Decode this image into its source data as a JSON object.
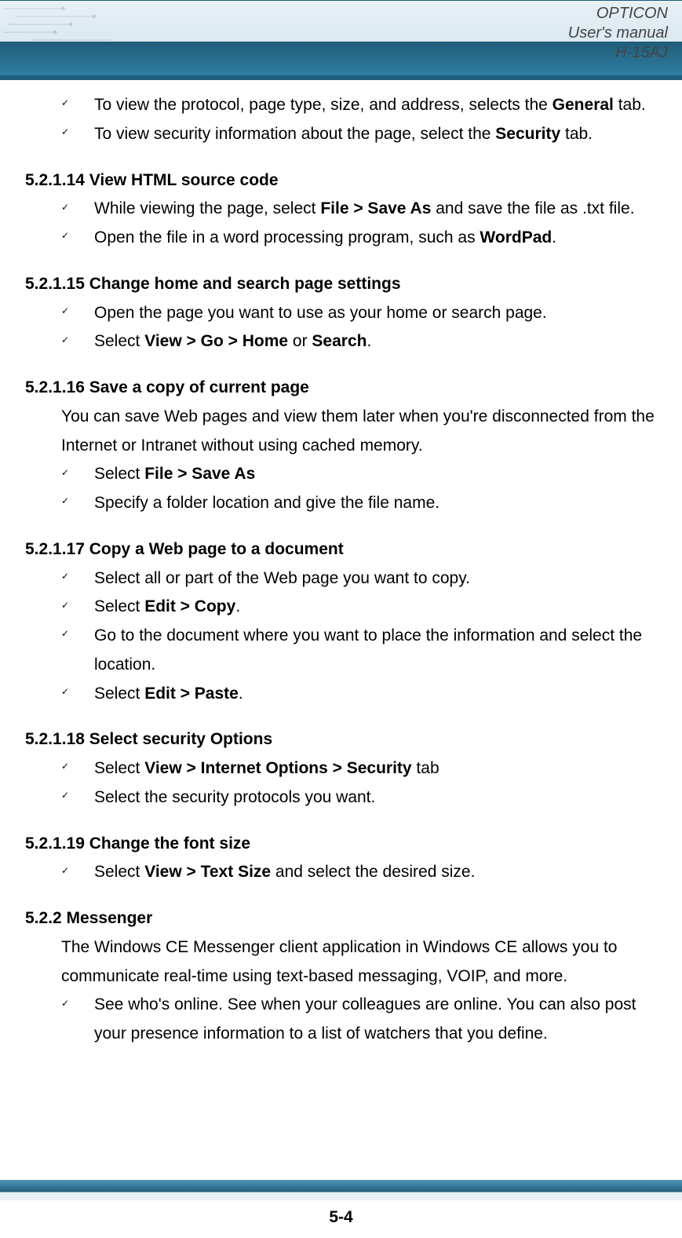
{
  "header": {
    "line1": "OPTICON",
    "line2": "User's manual",
    "line3": "H-15AJ"
  },
  "intro_items": [
    {
      "pre": "To view the protocol, page type, size, and address, selects the ",
      "bold": "General",
      "post": " tab."
    },
    {
      "pre": "To view security information about the page, select the ",
      "bold": "Security",
      "post": " tab."
    }
  ],
  "sections": [
    {
      "heading": "5.2.1.14 View HTML source code",
      "items": [
        {
          "pre": "While viewing the page, select ",
          "bold": "File > Save As",
          "post": " and save the file as .txt file."
        },
        {
          "pre": "Open the file in a word processing program, such as ",
          "bold": "WordPad",
          "post": "."
        }
      ]
    },
    {
      "heading": "5.2.1.15 Change home and search page settings",
      "items": [
        {
          "pre": "Open the page you want to use as your home or search page.",
          "bold": "",
          "post": ""
        },
        {
          "pre": "Select ",
          "bold": "View > Go > Home",
          "post": " or ",
          "bold2": "Search",
          "post2": "."
        }
      ]
    },
    {
      "heading": "5.2.1.16 Save a copy of current page",
      "para": "You can save Web pages and view them later when you're disconnected from the Internet or Intranet without using cached memory.",
      "items": [
        {
          "pre": "Select ",
          "bold": "File > Save As",
          "post": ""
        },
        {
          "pre": "Specify a folder location and give the file name.",
          "bold": "",
          "post": ""
        }
      ]
    },
    {
      "heading": "5.2.1.17 Copy a Web page to a document",
      "items": [
        {
          "pre": "Select all or part of the Web page you want to copy.",
          "bold": "",
          "post": ""
        },
        {
          "pre": "Select ",
          "bold": "Edit > Copy",
          "post": "."
        },
        {
          "pre": "Go to the document where you want to place the information and select the location.",
          "bold": "",
          "post": ""
        },
        {
          "pre": "Select ",
          "bold": "Edit > Paste",
          "post": "."
        }
      ]
    },
    {
      "heading": "5.2.1.18 Select security Options",
      "items": [
        {
          "pre": "Select ",
          "bold": "View > Internet Options > Security",
          "post": " tab"
        },
        {
          "pre": "Select the security protocols you want.",
          "bold": "",
          "post": ""
        }
      ]
    },
    {
      "heading": "5.2.1.19 Change the font size",
      "items": [
        {
          "pre": "Select ",
          "bold": "View > Text Size",
          "post": " and select the desired size."
        }
      ]
    },
    {
      "heading": "5.2.2 Messenger",
      "para": "The Windows CE Messenger client application in Windows CE allows you to communicate real-time using text-based messaging, VOIP, and more.",
      "items": [
        {
          "pre": "See who's online. See when your colleagues are online. You can also post your presence information to a list of watchers that you define.",
          "bold": "",
          "post": ""
        }
      ]
    }
  ],
  "page_number": "5-4"
}
